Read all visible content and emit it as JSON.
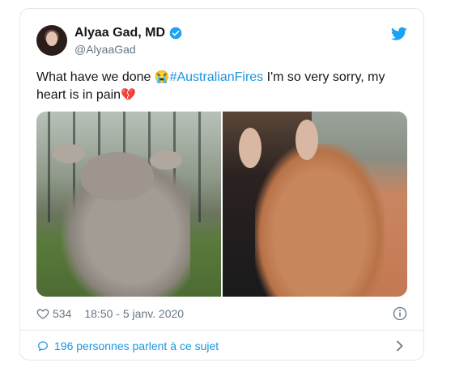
{
  "tweet": {
    "author_name": "Alyaa Gad, MD",
    "author_handle": "@AlyaaGad",
    "text_before": "What have we done ",
    "emoji_crying": "😭",
    "hashtag": "#AustralianFires",
    "text_after": " I'm so very sorry, my heart is in pain",
    "emoji_broken_heart": "💔",
    "likes": "534",
    "timestamp": "18:50 - 5 janv. 2020",
    "conversation_link": "196 personnes parlent à ce sujet"
  },
  "icons": {
    "verified": "verified-badge-icon",
    "brand": "twitter-bird-icon",
    "like": "heart-icon",
    "info": "info-icon",
    "conversation": "comment-icon",
    "open": "chevron-right-icon"
  },
  "colors": {
    "brand": "#1da1f2",
    "link": "#1b95e0",
    "muted": "#657786",
    "text": "#14171a",
    "border": "#e1e8ed"
  }
}
